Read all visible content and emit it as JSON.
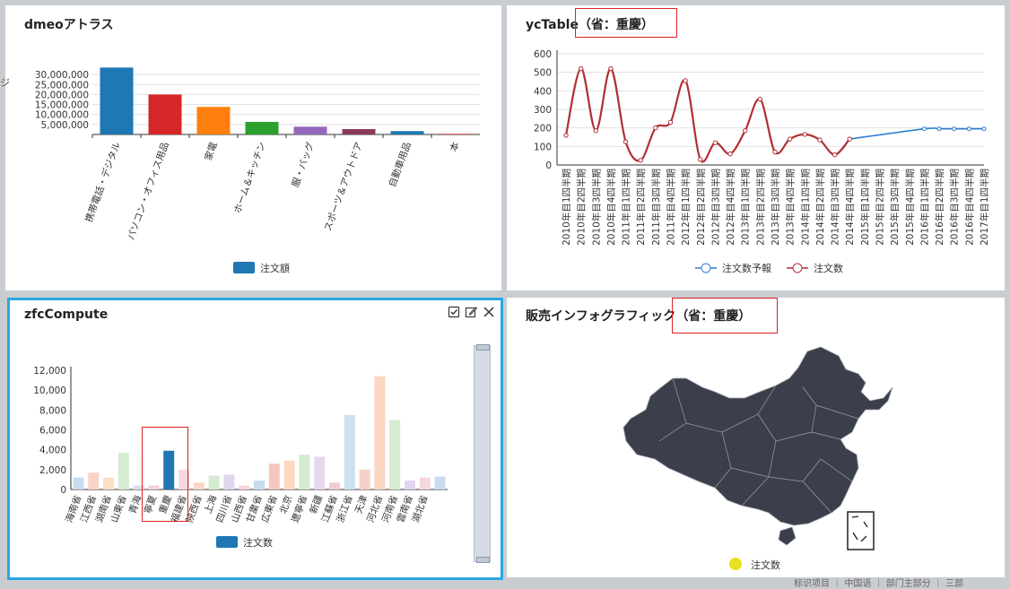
{
  "panels": {
    "tl": {
      "title": "dmeoアトラス"
    },
    "tr": {
      "title": "ycTable",
      "title_suffix": "（省：重慶）"
    },
    "bl": {
      "title": "zfcCompute"
    },
    "br": {
      "title": "販売インフォグラフィック",
      "title_suffix": "（省：重慶）"
    }
  },
  "left_edge_glyph": "ジ",
  "bottom_edge_text": "标识项目 ｜ 中国语 ｜ 部门主部分 ｜ 三部",
  "colors": {
    "accent": "#29a8e0",
    "red_box": "#d22222",
    "map_fill": "#3a3f4b",
    "legend_dot": "#e8e020"
  },
  "chart_data": [
    {
      "type": "bar",
      "title": "",
      "categories": [
        "携帯電話・デジタル",
        "パソコン・オフィス用品",
        "家電",
        "ホーム＆キッチン",
        "服・バッグ",
        "スポーツ＆アウトドア",
        "自動車用品",
        "本"
      ],
      "series": [
        {
          "name": "注文額",
          "values": [
            33500000,
            20000000,
            13800000,
            6300000,
            3900000,
            2700000,
            1700000,
            300000
          ]
        }
      ],
      "colors": [
        "#1f77b4",
        "#d62728",
        "#ff7f0e",
        "#2ca02c",
        "#9467bd",
        "#8c3a5c",
        "#1f77b4",
        "#d62728"
      ],
      "yticks": [
        "5,000,000",
        "10,000,000",
        "15,000,000",
        "20,000,000",
        "25,000,000",
        "30,000,000"
      ],
      "ylim": [
        0,
        35000000
      ],
      "legend": "bottom"
    },
    {
      "type": "line",
      "title": "",
      "categories": [
        "2010年目1四半期",
        "2010年目2四半期",
        "2010年目3四半期",
        "2010年目4四半期",
        "2011年目1四半期",
        "2011年目2四半期",
        "2011年目3四半期",
        "2011年目4四半期",
        "2012年目1四半期",
        "2012年目2四半期",
        "2012年目3四半期",
        "2012年目4四半期",
        "2013年目1四半期",
        "2013年目2四半期",
        "2013年目3四半期",
        "2013年目4四半期",
        "2014年目1四半期",
        "2014年目2四半期",
        "2014年目3四半期",
        "2014年目4四半期",
        "2015年目1四半期",
        "2015年目2四半期",
        "2015年目3四半期",
        "2015年目4四半期",
        "2016年目1四半期",
        "2016年目2四半期",
        "2016年目3四半期",
        "2016年目4四半期",
        "2017年目1四半期"
      ],
      "series": [
        {
          "name": "注文数予報",
          "values": [
            null,
            null,
            null,
            null,
            null,
            null,
            null,
            null,
            null,
            null,
            null,
            null,
            null,
            null,
            null,
            null,
            null,
            null,
            null,
            null,
            null,
            null,
            null,
            null,
            195,
            195,
            195,
            195,
            195
          ]
        },
        {
          "name": "注文数",
          "values": [
            160,
            520,
            185,
            520,
            125,
            25,
            200,
            230,
            455,
            30,
            120,
            60,
            185,
            355,
            70,
            140,
            165,
            135,
            55,
            140
          ]
        }
      ],
      "forecast_start_index": 19,
      "forecast_first_value": 140,
      "colors": [
        "#2f7fd0",
        "#b03035"
      ],
      "yticks": [
        "0",
        "100",
        "200",
        "300",
        "400",
        "500",
        "600"
      ],
      "ylim": [
        0,
        600
      ],
      "legend": "bottom"
    },
    {
      "type": "bar",
      "title": "",
      "categories": [
        "海南省",
        "江西省",
        "湖南省",
        "山東省",
        "青海",
        "寧夏",
        "重慶",
        "福建省",
        "陝西省",
        "上海",
        "四川省",
        "山西省",
        "甘粛省",
        "広東省",
        "北京",
        "遼寧省",
        "新疆",
        "江蘇省",
        "浙江省",
        "天津",
        "河北省",
        "河南省",
        "雲南省",
        "湖北省"
      ],
      "series": [
        {
          "name": "注文数",
          "values": [
            1200,
            1700,
            1200,
            3700,
            400,
            400,
            3900,
            2000,
            700,
            1400,
            1500,
            400,
            900,
            2600,
            2900,
            3500,
            3300,
            700,
            7500,
            2000,
            11400,
            7000,
            900,
            1200,
            1300
          ]
        }
      ],
      "highlight": "重慶",
      "colors": [
        "#c9dbef",
        "#fbd3c5",
        "#fce0c5",
        "#d6ecd3",
        "#e3d9ee",
        "#f3d3da",
        "#1f77b4",
        "#f6d8dd",
        "#fad6c8",
        "#d5ebd1",
        "#e1d6ee",
        "#f6d6da",
        "#c9dcef",
        "#f4c8c0",
        "#fcd9c0",
        "#d3ebcf",
        "#e3d8ee",
        "#f1cdd3",
        "#cde0f2",
        "#f6d1c8",
        "#fcd6c0",
        "#d6ecd1",
        "#e0d5ed",
        "#f6d7dc",
        "#c9dcef"
      ],
      "yticks": [
        "0",
        "2,000",
        "4,000",
        "6,000",
        "8,000",
        "10,000",
        "12,000"
      ],
      "ylim": [
        0,
        12000
      ],
      "legend": "bottom"
    },
    {
      "type": "map",
      "title": "",
      "legend": {
        "label": "注文数",
        "color": "#e8e020"
      }
    }
  ]
}
